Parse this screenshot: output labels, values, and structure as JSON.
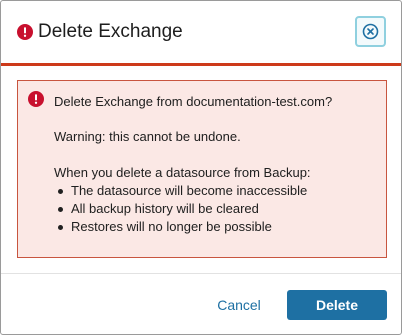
{
  "dialog": {
    "title": "Delete Exchange",
    "title_icon": "error-icon",
    "close_icon": "close-circle-icon"
  },
  "alert": {
    "icon": "error-icon",
    "heading": "Delete Exchange from documentation-test.com?",
    "warning": "Warning: this cannot be undone.",
    "intro": "When you delete a datasource from Backup:",
    "items": [
      "The datasource will become inaccessible",
      "All backup history will be cleared",
      "Restores will no longer be possible"
    ]
  },
  "footer": {
    "cancel_label": "Cancel",
    "delete_label": "Delete"
  },
  "colors": {
    "error_red": "#c8102e",
    "header_rule": "#cd3a1a",
    "alert_background": "#fbe8e5",
    "alert_border": "#c8553f",
    "primary_blue": "#1e70a3",
    "close_border": "#8fd0df"
  }
}
